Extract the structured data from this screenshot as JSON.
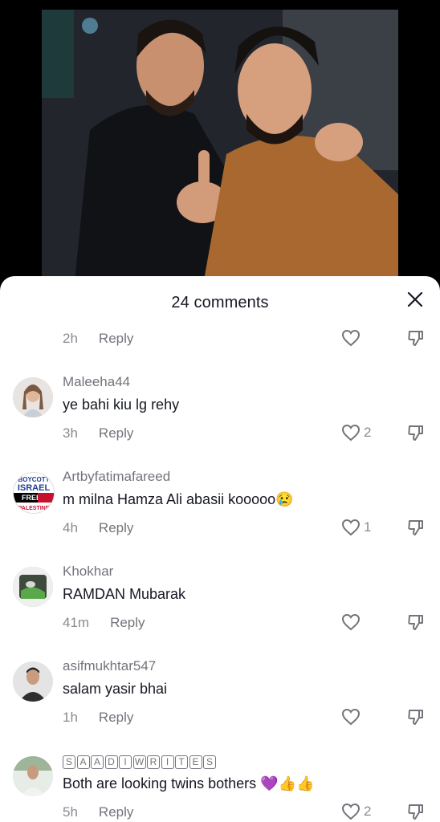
{
  "header": {
    "title": "24 comments"
  },
  "comments": [
    {
      "username": "",
      "text": "",
      "time": "2h",
      "reply": "Reply",
      "likes": ""
    },
    {
      "username": "Maleeha44",
      "text": "ye bahi kiu lg rehy",
      "time": "3h",
      "reply": "Reply",
      "likes": "2"
    },
    {
      "username": "Artbyfatimafareed",
      "text": "m milna Hamza Ali abasii kooooo😢",
      "time": "4h",
      "reply": "Reply",
      "likes": "1",
      "avatar_text": [
        "BOYCOTT",
        "ISRAEL",
        "FREE",
        "PALESTINE"
      ]
    },
    {
      "username": "Khokhar",
      "text": "RAMDAN Mubarak",
      "time": "41m",
      "reply": "Reply",
      "likes": ""
    },
    {
      "username": "asifmukhtar547",
      "text": "salam yasir bhai",
      "time": "1h",
      "reply": "Reply",
      "likes": ""
    },
    {
      "username": "SAADIWRITES",
      "text": "Both are looking twins bothers 💜👍👍",
      "time": "5h",
      "reply": "Reply",
      "likes": "2"
    }
  ],
  "icons": {
    "like": "heart-outline-icon",
    "dislike": "thumbs-down-icon",
    "close": "close-icon"
  },
  "colors": {
    "text_primary": "#161823",
    "text_secondary": "#73747b",
    "sheet_bg": "#ffffff"
  }
}
